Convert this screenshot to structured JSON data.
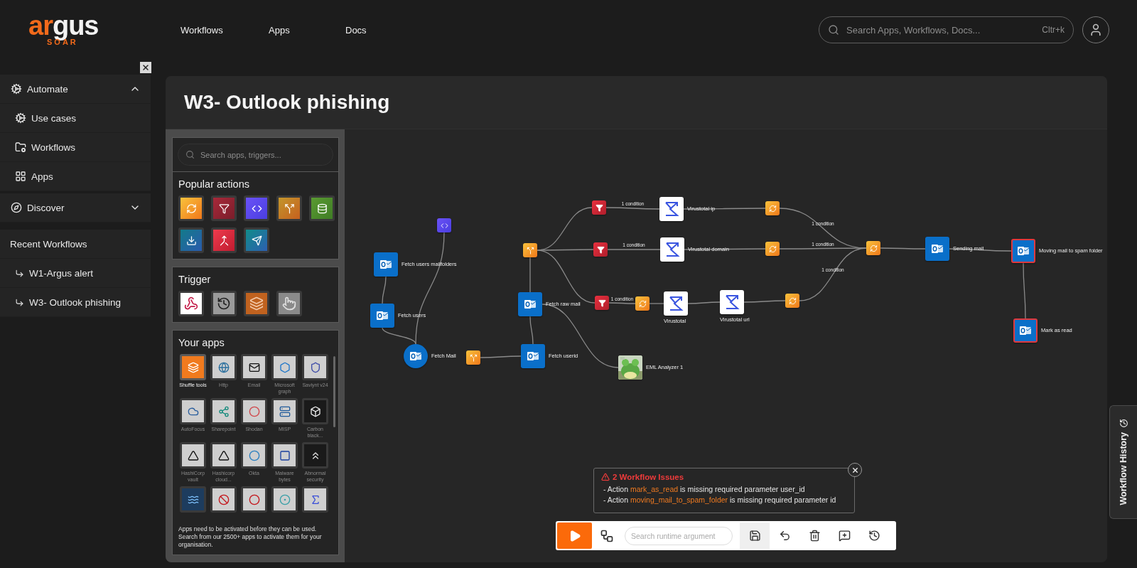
{
  "header": {
    "logo": {
      "parts": [
        "ar",
        "gus"
      ],
      "tagline": "SOAR"
    },
    "nav": [
      {
        "label": "Workflows"
      },
      {
        "label": "Apps"
      },
      {
        "label": "Docs"
      }
    ],
    "search": {
      "placeholder": "Search Apps, Workflows, Docs...",
      "shortcut": "Cltr+k"
    }
  },
  "sidebar": {
    "sections": [
      {
        "label": "Automate",
        "expanded": true,
        "items": [
          {
            "label": "Use cases"
          },
          {
            "label": "Workflows"
          },
          {
            "label": "Apps"
          }
        ]
      },
      {
        "label": "Discover",
        "expanded": false
      }
    ],
    "recent": {
      "title": "Recent Workflows",
      "items": [
        {
          "label": "W1-Argus alert"
        },
        {
          "label": "W3- Outlook phishing"
        }
      ]
    }
  },
  "workflow": {
    "title": "W3- Outlook phishing"
  },
  "palette": {
    "search": {
      "placeholder": "Search apps, triggers..."
    },
    "popular_title": "Popular actions",
    "trigger_title": "Trigger",
    "apps_title": "Your apps",
    "apps": [
      {
        "label": "Shuffle tools",
        "active": true
      },
      {
        "label": "Http",
        "active": false
      },
      {
        "label": "Email",
        "active": false
      },
      {
        "label": "Microsoft graph",
        "active": false
      },
      {
        "label": "Saviynt v24",
        "active": false
      },
      {
        "label": "AutoFocus",
        "active": false
      },
      {
        "label": "Sharepoint",
        "active": false
      },
      {
        "label": "Shodan",
        "active": false
      },
      {
        "label": "MISP",
        "active": false
      },
      {
        "label": "Carbon black...",
        "active": false
      },
      {
        "label": "HashiCorp vault",
        "active": false
      },
      {
        "label": "Hashicorp cloud...",
        "active": false
      },
      {
        "label": "Okta",
        "active": false
      },
      {
        "label": "Malware bytes",
        "active": false
      },
      {
        "label": "Abnormal security",
        "active": false
      },
      {
        "active": false
      },
      {
        "active": false
      },
      {
        "active": false
      },
      {
        "active": false
      },
      {
        "active": false
      }
    ],
    "note": "Apps need to be activated before they can be used. Search from our 2500+ apps to activate them for your organisation."
  },
  "canvas": {
    "nodes": [
      {
        "kind": "outlook",
        "label": "Fetch users mailfolders",
        "error": false
      },
      {
        "kind": "outlook",
        "label": "Fetch users",
        "error": false
      },
      {
        "kind": "outlook-start",
        "label": "Fetch Mail",
        "error": false
      },
      {
        "kind": "code",
        "error": false
      },
      {
        "kind": "transform",
        "error": false
      },
      {
        "kind": "outlook",
        "label": "Fetch userid",
        "error": false
      },
      {
        "kind": "outlook",
        "label": "Fetch raw mail",
        "error": false
      },
      {
        "kind": "transform",
        "error": false
      },
      {
        "kind": "filter",
        "error": false
      },
      {
        "kind": "filter",
        "error": false
      },
      {
        "kind": "filter",
        "error": false
      },
      {
        "kind": "sync",
        "error": false
      },
      {
        "kind": "sigma",
        "label": "Virustotal ip",
        "error": false
      },
      {
        "kind": "sigma",
        "label": "Virustotal domain",
        "error": false
      },
      {
        "kind": "sigma",
        "label": "Virustotal",
        "error": false
      },
      {
        "kind": "sigma",
        "label": "Virustotal url",
        "error": false
      },
      {
        "kind": "picture",
        "label": "EML Analyzer 1",
        "error": false
      },
      {
        "kind": "sync",
        "error": false
      },
      {
        "kind": "sync",
        "error": false
      },
      {
        "kind": "sync",
        "error": false
      },
      {
        "kind": "sync",
        "error": false
      },
      {
        "kind": "outlook",
        "label": "Sending mail",
        "error": false
      },
      {
        "kind": "outlook",
        "label": "Moving mail to spam folder",
        "error": true
      },
      {
        "kind": "outlook",
        "label": "Mark as read",
        "error": true
      }
    ],
    "edge_labels": [
      "1 condition",
      "1 condition",
      "1 condition",
      "1 condition",
      "1 condition",
      "1 condition"
    ]
  },
  "issues": {
    "title": "2 Workflow Issues",
    "items": [
      {
        "prefix": "- Action",
        "action": "mark_as_read",
        "message": "is missing required parameter user_id"
      },
      {
        "prefix": "- Action",
        "action": "moving_mail_to_spam_folder",
        "message": "is missing required parameter id"
      }
    ]
  },
  "toolbar": {
    "search_placeholder": "Search runtime argument",
    "tools": [
      {
        "selected": true
      },
      {
        "selected": false
      },
      {
        "selected": false
      },
      {
        "selected": false
      },
      {
        "selected": false
      }
    ]
  },
  "history_tab": {
    "label": "Workflow History"
  }
}
